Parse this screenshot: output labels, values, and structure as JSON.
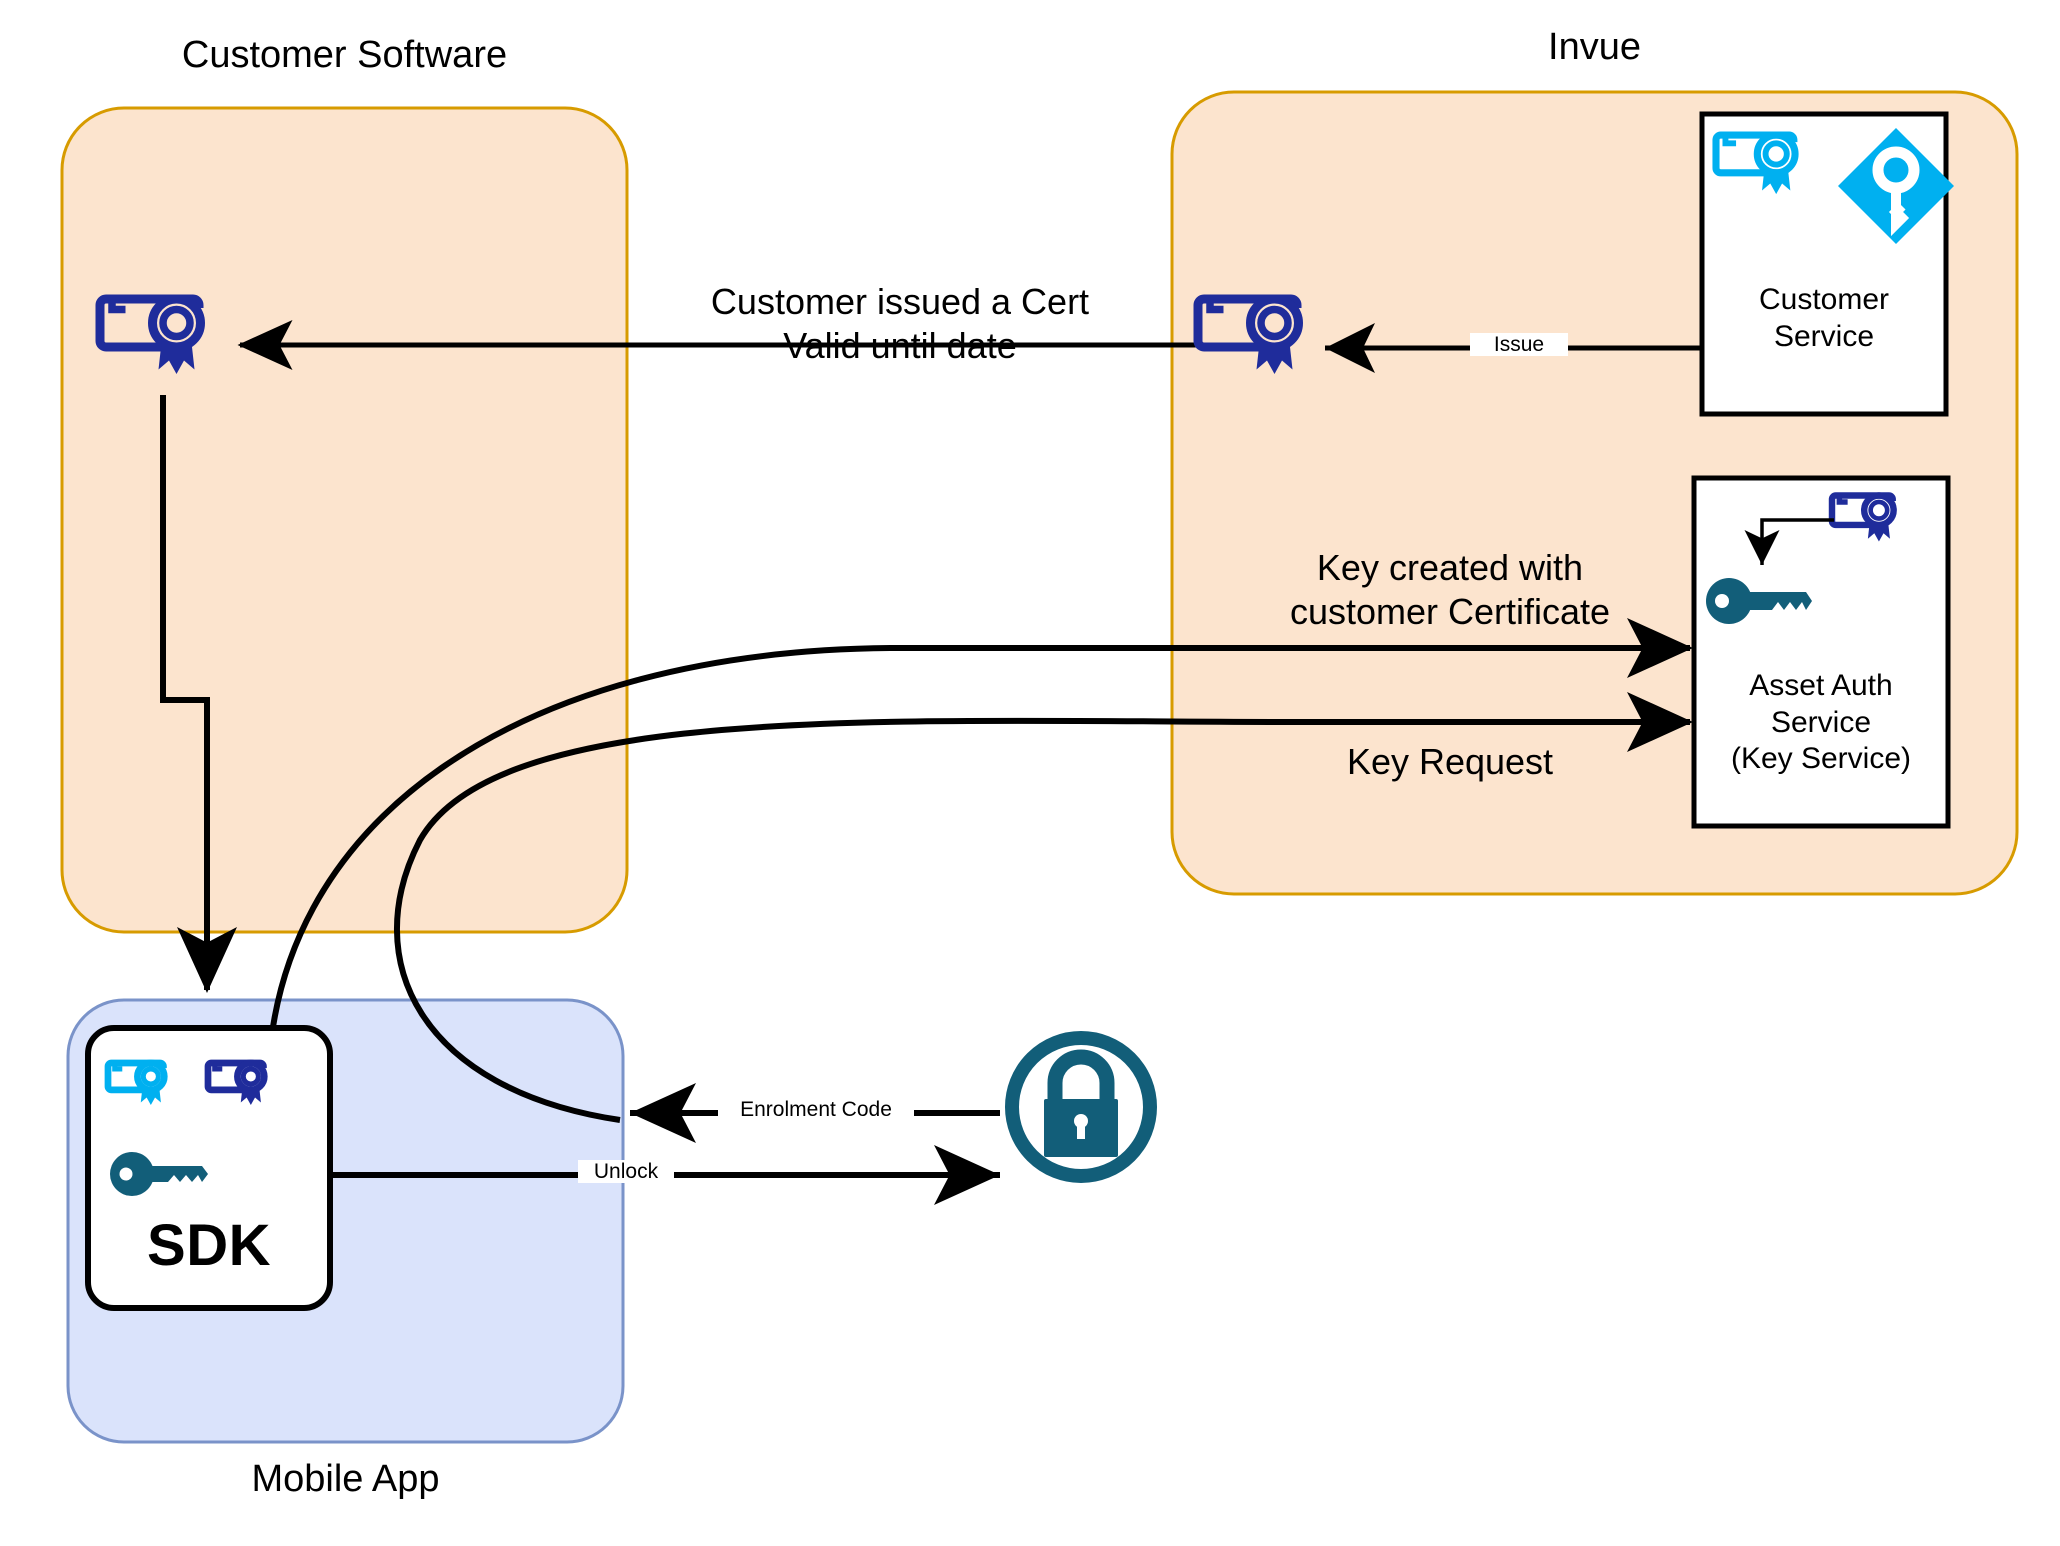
{
  "diagram": {
    "title_customer": "Customer Software",
    "title_invue": "Invue",
    "title_mobile": "Mobile App"
  },
  "colors": {
    "zone_orange_fill": "#FCE4CE",
    "zone_orange_stroke": "#D79B00",
    "zone_blue_fill": "#DAE3FB",
    "zone_blue_stroke": "#7A93C9",
    "cert_cyan": "#00B0F0",
    "cert_navy": "#1F2C9B",
    "key_teal": "#125E79",
    "diamond_cyan": "#00B0F0",
    "arrow_black": "#000000",
    "box_white": "#FFFFFF"
  },
  "nodes": {
    "customer_cert": {
      "icon": "certificate-icon",
      "label": ""
    },
    "invue_cert": {
      "icon": "certificate-icon",
      "label": ""
    },
    "customer_service": {
      "label": "Customer\nService",
      "icons": [
        "certificate-icon",
        "key-diamond-icon"
      ]
    },
    "asset_auth_service": {
      "label": "Asset Auth\nService\n(Key Service)",
      "icons": [
        "certificate-icon",
        "arrow-down-icon",
        "key-icon"
      ]
    },
    "sdk": {
      "label": "SDK",
      "icons": [
        "certificate-icon-cyan",
        "certificate-icon-navy",
        "key-icon"
      ]
    },
    "lock": {
      "icon": "padlock-icon",
      "label": ""
    }
  },
  "edges": [
    {
      "id": "customer-issued-cert",
      "label": "Customer issued a Cert\nValid until date",
      "from": "invue_cert",
      "to": "customer_cert",
      "size": "large"
    },
    {
      "id": "issue",
      "label": "Issue",
      "from": "customer_service",
      "to": "invue_cert",
      "size": "small"
    },
    {
      "id": "key-created",
      "label": "Key created with\ncustomer Certificate",
      "from": "sdk",
      "to": "asset_auth_service",
      "size": "large"
    },
    {
      "id": "key-request",
      "label": "Key Request",
      "from": "sdk",
      "to": "asset_auth_service",
      "size": "large"
    },
    {
      "id": "enrolment-code",
      "label": "Enrolment Code",
      "from": "lock",
      "to": "sdk",
      "size": "small"
    },
    {
      "id": "unlock",
      "label": "Unlock",
      "from": "sdk",
      "to": "lock",
      "size": "small"
    }
  ]
}
